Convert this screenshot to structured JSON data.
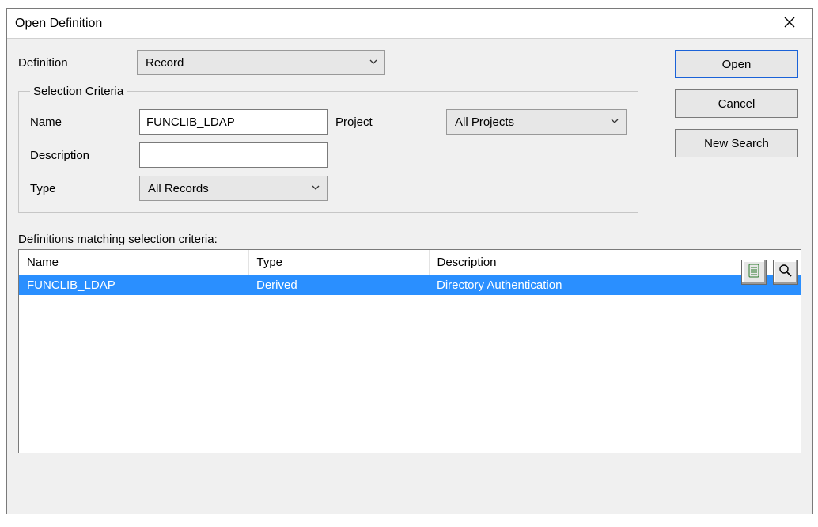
{
  "window": {
    "title": "Open Definition"
  },
  "definition_row": {
    "label": "Definition",
    "dropdown_value": "Record"
  },
  "criteria": {
    "legend": "Selection Criteria",
    "name_label": "Name",
    "name_value": "FUNCLIB_LDAP",
    "project_label": "Project",
    "project_value": "All Projects",
    "description_label": "Description",
    "description_value": "",
    "type_label": "Type",
    "type_value": "All Records"
  },
  "buttons": {
    "open": "Open",
    "cancel": "Cancel",
    "new_search": "New Search"
  },
  "list_label": "Definitions matching selection criteria:",
  "columns": {
    "name": "Name",
    "type": "Type",
    "description": "Description"
  },
  "rows": [
    {
      "name": "FUNCLIB_LDAP",
      "type": "Derived",
      "description": "Directory Authentication"
    }
  ]
}
